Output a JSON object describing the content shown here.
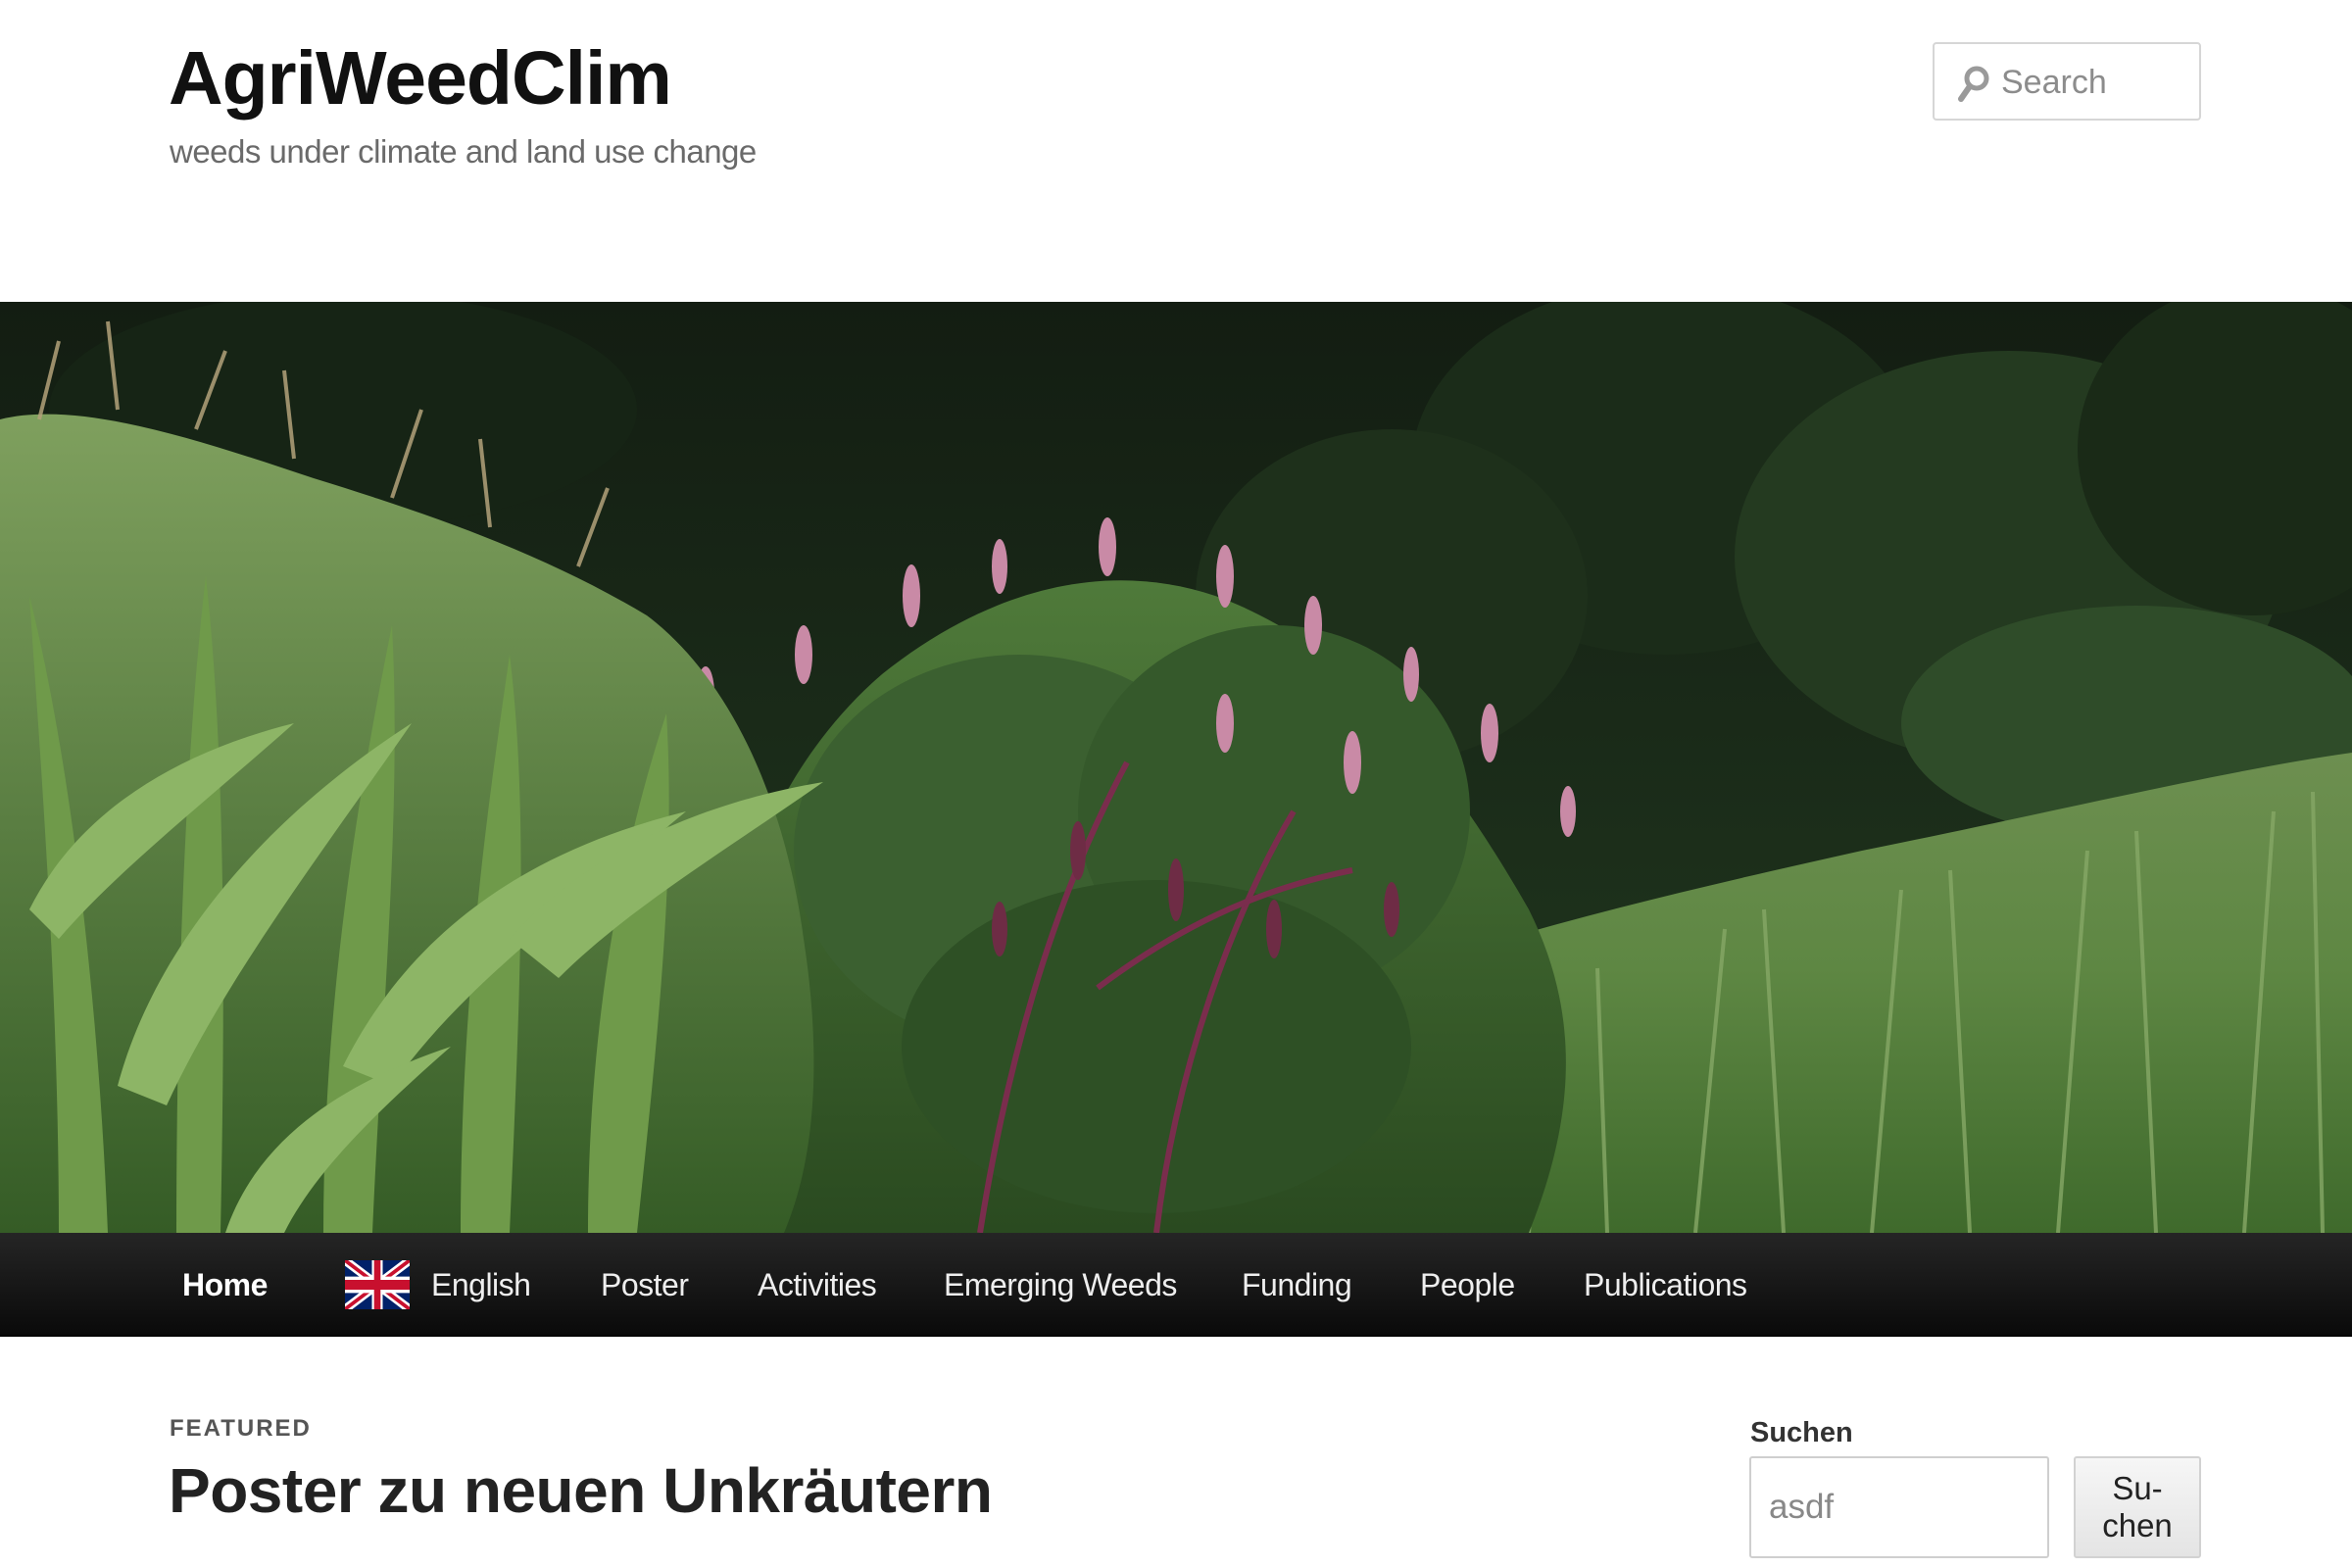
{
  "site": {
    "title": "AgriWeedClim",
    "tagline": "weeds under climate and land use change"
  },
  "header_search": {
    "placeholder": "Search",
    "icon": "search-icon"
  },
  "hero": {
    "icon": "hero-photo"
  },
  "nav": {
    "items": [
      {
        "label": "Home",
        "active": true
      },
      {
        "label": "English",
        "icon": "uk-flag-icon"
      },
      {
        "label": "Poster"
      },
      {
        "label": "Activities"
      },
      {
        "label": "Emerging Weeds"
      },
      {
        "label": "Funding"
      },
      {
        "label": "People"
      },
      {
        "label": "Publications"
      }
    ]
  },
  "content": {
    "featured_label": "FEATURED",
    "post_title": "Poster zu neuen Unkräutern"
  },
  "sidebar": {
    "search_widget": {
      "title": "Suchen",
      "value": "asdf",
      "button_label": "Su-\nchen"
    }
  },
  "colors": {
    "nav_background": "#111111",
    "title_text": "#111111",
    "tagline_text": "#6a6a6a"
  }
}
